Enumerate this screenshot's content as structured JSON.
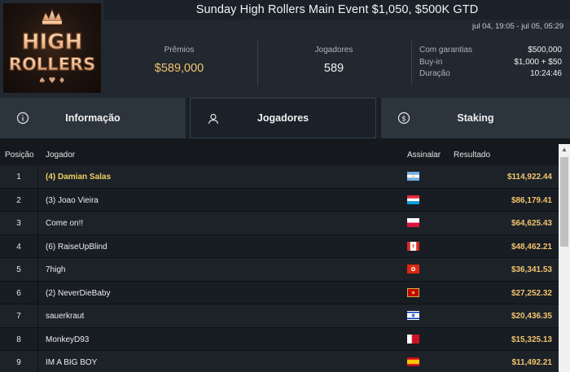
{
  "logo": {
    "line1": "HIGH",
    "line2": "ROLLERS"
  },
  "header": {
    "title": "Sunday High Rollers Main Event $1,050, $500K GTD",
    "dates": "jul 04, 19:05 - jul 05, 05:29"
  },
  "stats": {
    "prize_label": "Prêmios",
    "prize_value": "$589,000",
    "players_label": "Jogadores",
    "players_value": "589"
  },
  "details": [
    {
      "label": "Com garantias",
      "value": "$500,000"
    },
    {
      "label": "Buy-in",
      "value": "$1,000 + $50"
    },
    {
      "label": "Duração",
      "value": "10:24:46"
    }
  ],
  "tabs": [
    {
      "label": "Informação",
      "icon": "info-icon"
    },
    {
      "label": "Jogadores",
      "icon": "user-icon",
      "active": true
    },
    {
      "label": "Staking",
      "icon": "dollar-icon"
    }
  ],
  "table": {
    "headers": {
      "position": "Posição",
      "player": "Jogador",
      "flag": "Assinalar",
      "result": "Resultado"
    },
    "rows": [
      {
        "position": "1",
        "player": "(4) Damian Salas",
        "flag": "argentina-flag",
        "result": "$114,922.44"
      },
      {
        "position": "2",
        "player": "(3) Joao Vieira",
        "flag": "luxembourg-flag",
        "result": "$86,179.41"
      },
      {
        "position": "3",
        "player": "Come on!!",
        "flag": "poland-flag",
        "result": "$64,625.43"
      },
      {
        "position": "4",
        "player": "(6) RaiseUpBlind",
        "flag": "canada-flag",
        "result": "$48,462.21"
      },
      {
        "position": "5",
        "player": "7high",
        "flag": "hong-kong-flag",
        "result": "$36,341.53"
      },
      {
        "position": "6",
        "player": "(2) NeverDieBaby",
        "flag": "montenegro-flag",
        "result": "$27,252.32"
      },
      {
        "position": "7",
        "player": "sauerkraut",
        "flag": "israel-flag",
        "result": "$20,436.35"
      },
      {
        "position": "8",
        "player": "MonkeyD93",
        "flag": "bahrain-flag",
        "result": "$15,325.13"
      },
      {
        "position": "9",
        "player": "IM A BIG BOY",
        "flag": "spain-flag",
        "result": "$11,492.21"
      }
    ]
  },
  "colors": {
    "accent_gold": "#f2c46d",
    "highlight_name": "#f0cf60",
    "header_bg": "#212830"
  }
}
